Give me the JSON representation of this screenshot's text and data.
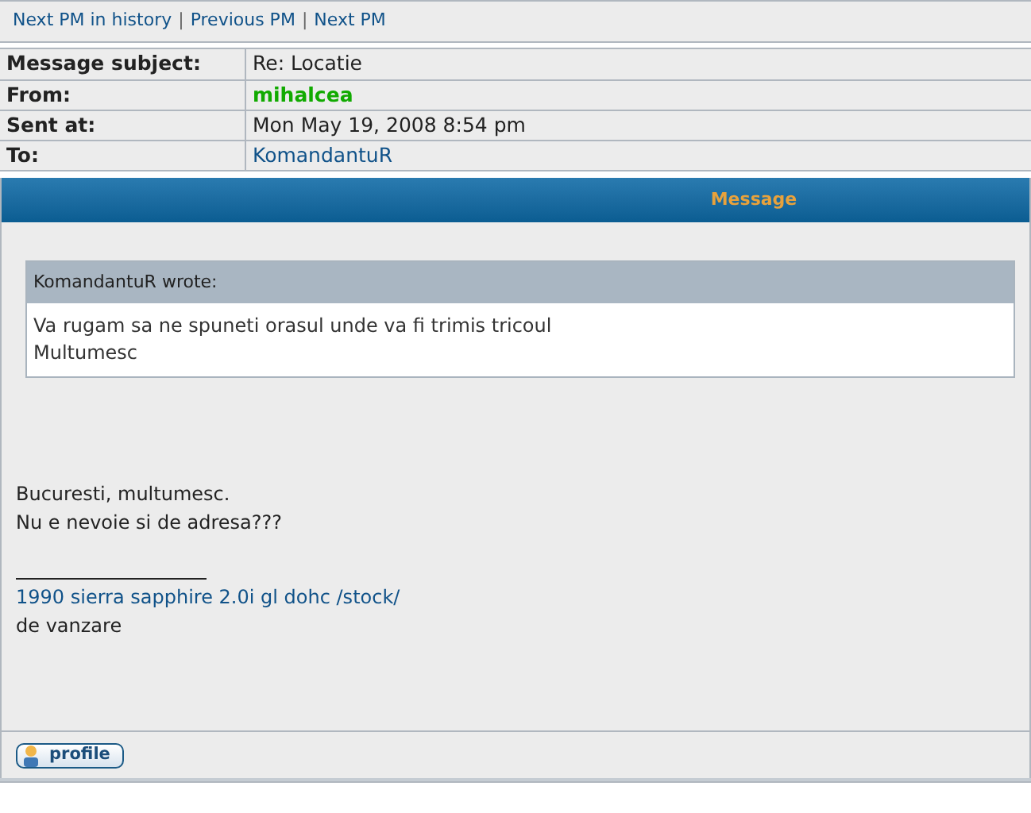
{
  "nav_links": [
    "Next PM in history",
    "Previous PM",
    "Next PM"
  ],
  "nav_separator": "|",
  "details": [
    {
      "label": "Message subject:",
      "value": "Re: Locatie",
      "kind": "text"
    },
    {
      "label": "From:",
      "value": "mihalcea",
      "kind": "user"
    },
    {
      "label": "Sent at:",
      "value": "Mon May 19, 2008 8:54 pm",
      "kind": "text"
    },
    {
      "label": "To:",
      "value": "KomandantuR",
      "kind": "link"
    }
  ],
  "header": "Message",
  "quote": {
    "author": "KomandantuR wrote:",
    "lines": [
      "Va rugam sa ne spuneti orasul unde va fi trimis tricoul",
      "Multumesc"
    ]
  },
  "body": [
    "Bucuresti, multumesc.",
    "Nu e nevoie si de adresa???"
  ],
  "signature": [
    {
      "text": "1990 sierra sapphire 2.0i gl dohc /stock/",
      "kind": "link"
    },
    {
      "text": "de vanzare",
      "kind": "text"
    }
  ],
  "profile_button": "profile"
}
